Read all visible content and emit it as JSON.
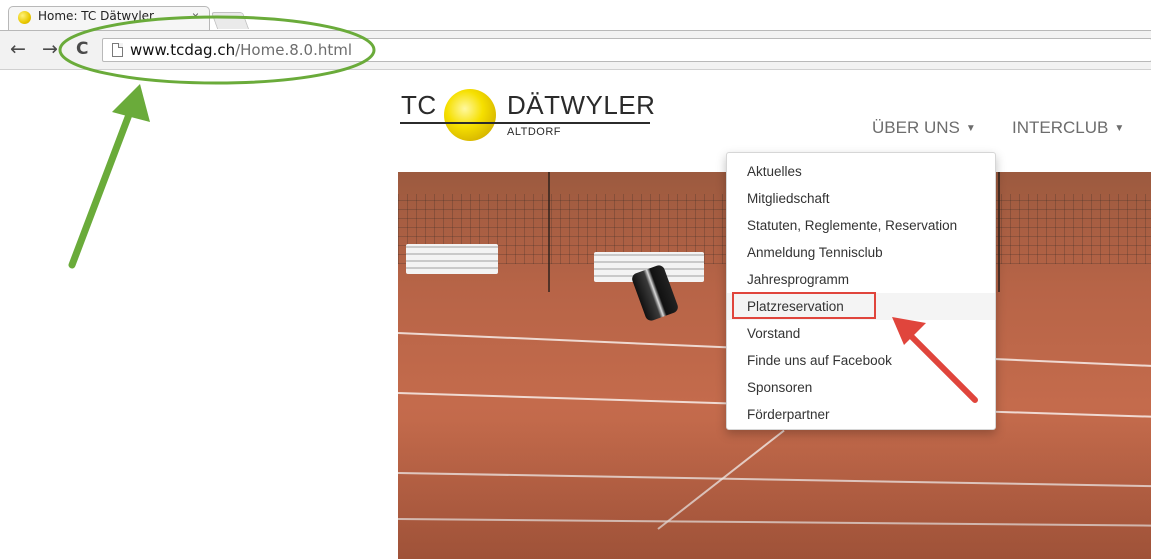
{
  "browser": {
    "tab": {
      "title": "Home: TC Dätwyler",
      "close_glyph": "×",
      "favicon": "tennis-ball-icon"
    },
    "nav": {
      "back_glyph": "←",
      "forward_glyph": "→",
      "reload_glyph": "C"
    },
    "address": {
      "host": "www.tcdag.ch",
      "path": "/Home.8.0.html"
    }
  },
  "site": {
    "logo": {
      "left": "TC",
      "name": "DÄTWYLER",
      "sub": "ALTDORF"
    },
    "nav": [
      {
        "label": "ÜBER UNS"
      },
      {
        "label": "INTERCLUB"
      }
    ],
    "dropdown_items": [
      {
        "label": "Aktuelles"
      },
      {
        "label": "Mitgliedschaft"
      },
      {
        "label": "Statuten, Reglemente, Reservation"
      },
      {
        "label": "Anmeldung Tennisclub"
      },
      {
        "label": "Jahresprogramm"
      },
      {
        "label": "Platzreservation"
      },
      {
        "label": "Vorstand"
      },
      {
        "label": "Finde uns auf Facebook"
      },
      {
        "label": "Sponsoren"
      },
      {
        "label": "Förderpartner"
      }
    ],
    "active_item_index": 5
  },
  "annotations": {
    "green_color": "#6aab3a",
    "red_color": "#e0453c"
  }
}
